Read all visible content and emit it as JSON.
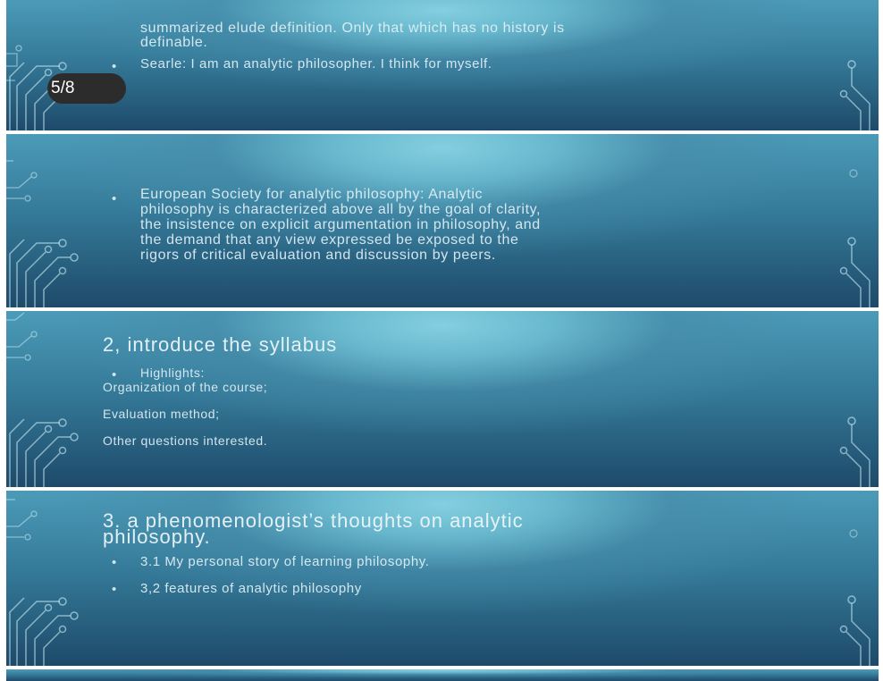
{
  "viewer": {
    "page_counter": "5/8"
  },
  "slides": [
    {
      "lines": [
        "summarized elude definition. Only that which has no history is",
        "definable."
      ],
      "bullet": "Searle: I am an analytic philosopher. I think for myself."
    },
    {
      "lines": [
        "European Society for analytic philosophy: Analytic",
        "philosophy is characterized above all by the goal of clarity,",
        "the insistence on explicit argumentation in philosophy, and",
        "the demand that any view expressed be exposed to the",
        "rigors of critical evaluation and discussion by peers."
      ]
    },
    {
      "title": "2, introduce the syllabus",
      "bullet": "Highlights:",
      "items": [
        "Organization of the course;",
        "Evaluation method;",
        "Other questions  interested."
      ]
    },
    {
      "title_lines": [
        "3. a phenomenologist’s thoughts on analytic",
        "philosophy."
      ],
      "bullets": [
        "3.1 My personal story of learning philosophy.",
        "3,2 features of analytic philosophy"
      ]
    }
  ]
}
